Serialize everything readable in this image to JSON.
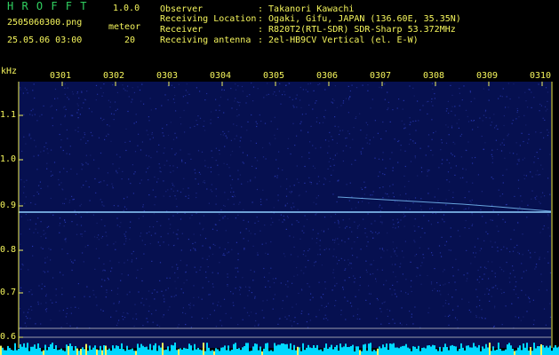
{
  "header": {
    "app_name": "H R O F F T",
    "version": "1.0.0",
    "filename": "2505060300.png",
    "datetime": "25.05.06 03:00",
    "meteor_label": "meteor",
    "meteor_count": "20",
    "info": [
      {
        "key": "Observer",
        "value": ": Takanori Kawachi"
      },
      {
        "key": "Receiving Location",
        "value": ": Ogaki, Gifu, JAPAN (136.60E, 35.35N)"
      },
      {
        "key": "Receiver",
        "value": ": R820T2(RTL-SDR) SDR-Sharp 53.372MHz"
      },
      {
        "key": "Receiving antenna",
        "value": ": 2el-HB9CV Vertical (el. E-W)"
      }
    ]
  },
  "plot": {
    "unit_label": "kHz",
    "time_ticks": [
      "0301",
      "0302",
      "0303",
      "0304",
      "0305",
      "0306",
      "0307",
      "0308",
      "0309",
      "0310"
    ],
    "freq_ticks": [
      "1.1",
      "1.0",
      "0.9",
      "0.8",
      "0.7",
      "0.6"
    ],
    "colors": {
      "background": "#000000",
      "noise": "#0a1a6e",
      "carrier": "#9fd8ff",
      "text": "#f5f55c",
      "title": "#30d060",
      "bars": "#00d8ff"
    }
  }
}
